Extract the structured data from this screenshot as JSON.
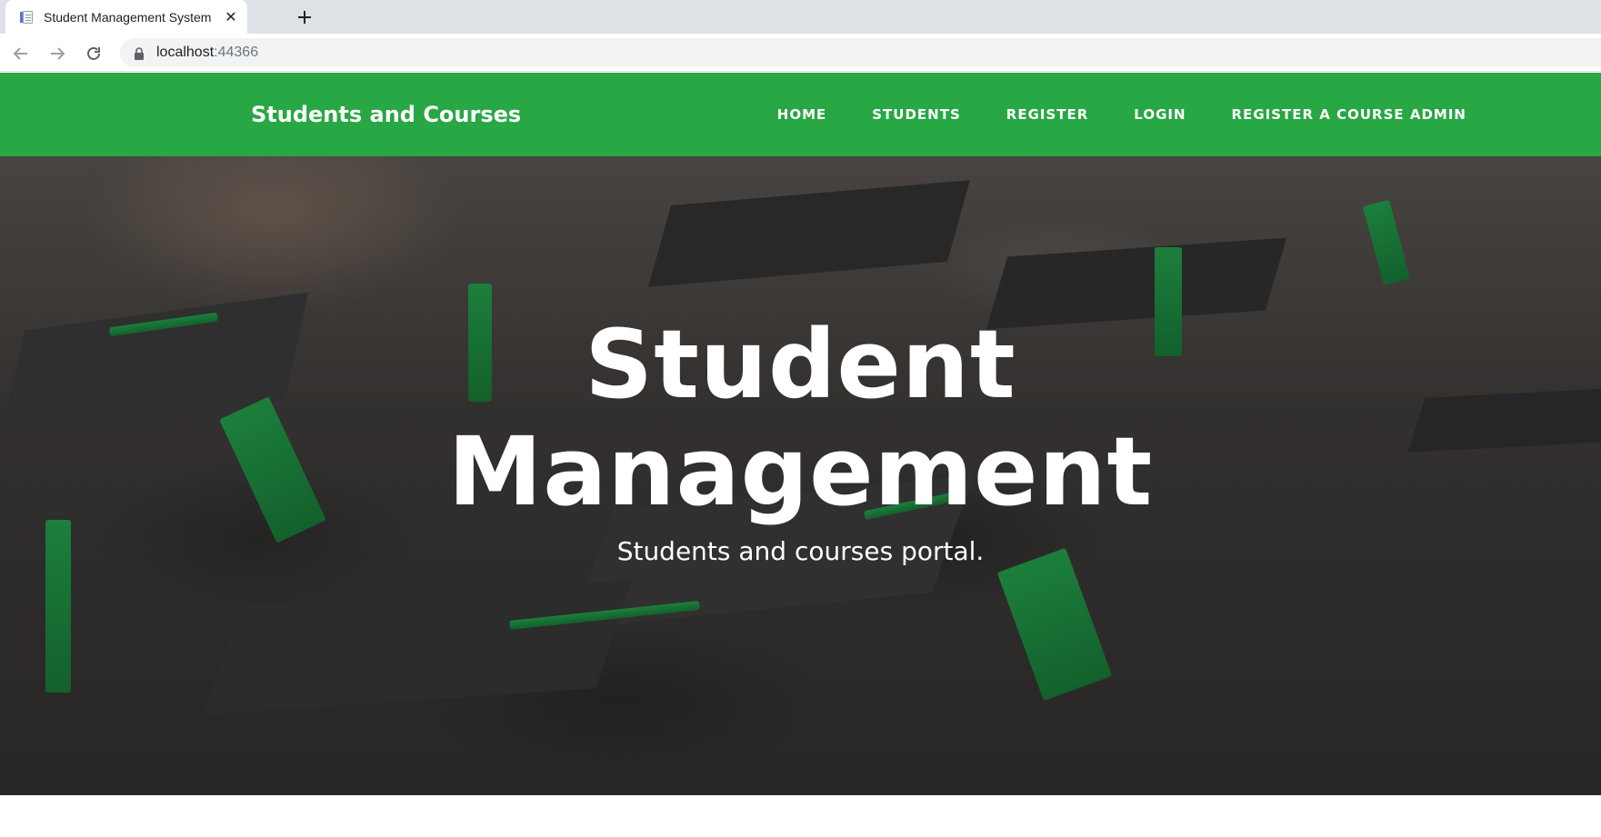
{
  "browser": {
    "tab_title": "Student Management System",
    "tab_close_glyph": "✕",
    "url_host": "localhost",
    "url_port": ":44366",
    "icons": [
      "page-favicon-icon",
      "close-icon",
      "plus-icon",
      "back-arrow-icon",
      "forward-arrow-icon",
      "reload-icon",
      "lock-icon"
    ]
  },
  "site": {
    "brand": "Students and Courses",
    "brand_color": "#28a745",
    "nav": {
      "home": "HOME",
      "students": "STUDENTS",
      "register": "REGISTER",
      "login": "LOGIN",
      "register_course_admin": "REGISTER A COURSE ADMIN"
    }
  },
  "hero": {
    "title_line1": "Student",
    "title_line2": "Management",
    "subtitle": "Students and courses portal."
  }
}
